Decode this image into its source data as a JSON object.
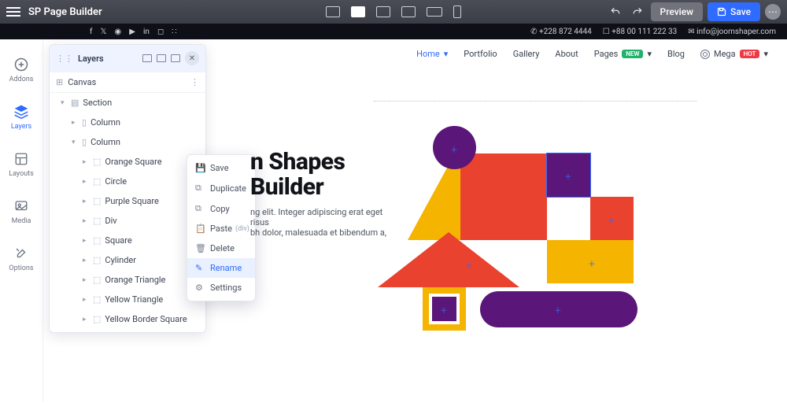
{
  "app": {
    "title": "SP Page Builder"
  },
  "topbar": {
    "preview": "Preview",
    "save": "Save"
  },
  "siterow": {
    "phone1": "+228 872 4444",
    "phone2": "+88 00 111 222 33",
    "email": "info@joomshaper.com"
  },
  "lefttool": {
    "addons": "Addons",
    "layers": "Layers",
    "layouts": "Layouts",
    "media": "Media",
    "options": "Options"
  },
  "layers": {
    "title": "Layers",
    "canvas": "Canvas",
    "section": "Section",
    "column1": "Column",
    "column2": "Column",
    "items": {
      "orange_square": "Orange Square",
      "circle": "Circle",
      "purple_square": "Purple Square",
      "div": "Div",
      "square": "Square",
      "cylinder": "Cylinder",
      "orange_triangle": "Orange Triangle",
      "yellow_triangle": "Yellow Triangle",
      "yellow_border_square": "Yellow Border Square"
    }
  },
  "ctx": {
    "save": "Save",
    "duplicate": "Duplicate",
    "copy": "Copy",
    "paste": "Paste",
    "paste_div": "(div)",
    "delete": "Delete",
    "rename": "Rename",
    "settings": "Settings"
  },
  "menu": {
    "home": "Home",
    "portfolio": "Portfolio",
    "gallery": "Gallery",
    "about": "About",
    "pages": "Pages",
    "pages_badge": "NEW",
    "blog": "Blog",
    "mega": "Mega",
    "mega_badge": "HOT"
  },
  "page": {
    "h1a": "n Shapes",
    "h1b": "Builder",
    "p1": "ng elit. Integer adipiscing erat eget risus",
    "p2": "bh dolor, malesuada et bibendum a,"
  }
}
